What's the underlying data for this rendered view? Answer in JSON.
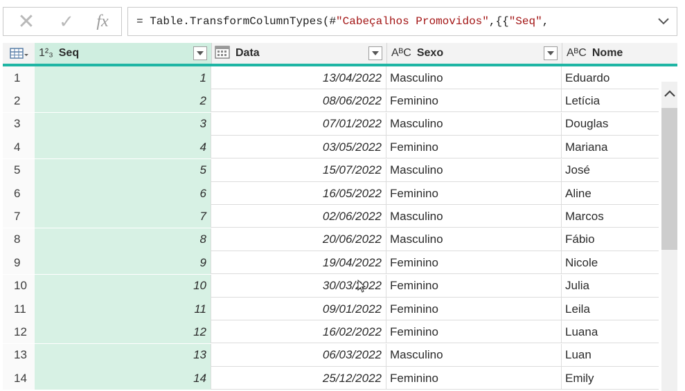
{
  "formula_bar": {
    "cancel_icon": "✕",
    "confirm_icon": "✓",
    "fx_label": "fx",
    "formula_prefix": "= Table.TransformColumnTypes(#",
    "formula_string": "\"Cabeçalhos Promovidos\"",
    "formula_mid": ",{{",
    "formula_string2": "\"Seq\"",
    "formula_suffix": ","
  },
  "columns": [
    {
      "type_icon": "1²₃",
      "label": "Seq"
    },
    {
      "type_icon": "calendar",
      "label": "Data"
    },
    {
      "type_icon": "AᴮC",
      "label": "Sexo"
    },
    {
      "type_icon": "AᴮC",
      "label": "Nome"
    }
  ],
  "rows": [
    {
      "n": "1",
      "seq": "1",
      "data": "13/04/2022",
      "sexo": "Masculino",
      "nome": "Eduardo"
    },
    {
      "n": "2",
      "seq": "2",
      "data": "08/06/2022",
      "sexo": "Feminino",
      "nome": "Letícia"
    },
    {
      "n": "3",
      "seq": "3",
      "data": "07/01/2022",
      "sexo": "Masculino",
      "nome": "Douglas"
    },
    {
      "n": "4",
      "seq": "4",
      "data": "03/05/2022",
      "sexo": "Feminino",
      "nome": "Mariana"
    },
    {
      "n": "5",
      "seq": "5",
      "data": "15/07/2022",
      "sexo": "Masculino",
      "nome": "José"
    },
    {
      "n": "6",
      "seq": "6",
      "data": "16/05/2022",
      "sexo": "Feminino",
      "nome": "Aline"
    },
    {
      "n": "7",
      "seq": "7",
      "data": "02/06/2022",
      "sexo": "Masculino",
      "nome": "Marcos"
    },
    {
      "n": "8",
      "seq": "8",
      "data": "20/06/2022",
      "sexo": "Masculino",
      "nome": "Fábio"
    },
    {
      "n": "9",
      "seq": "9",
      "data": "19/04/2022",
      "sexo": "Feminino",
      "nome": "Nicole"
    },
    {
      "n": "10",
      "seq": "10",
      "data": "30/03/2022",
      "sexo": "Feminino",
      "nome": "Julia"
    },
    {
      "n": "11",
      "seq": "11",
      "data": "09/01/2022",
      "sexo": "Feminino",
      "nome": "Leila"
    },
    {
      "n": "12",
      "seq": "12",
      "data": "16/02/2022",
      "sexo": "Feminino",
      "nome": "Luana"
    },
    {
      "n": "13",
      "seq": "13",
      "data": "06/03/2022",
      "sexo": "Masculino",
      "nome": "Luan"
    },
    {
      "n": "14",
      "seq": "14",
      "data": "25/12/2022",
      "sexo": "Feminino",
      "nome": "Emily"
    }
  ],
  "colors": {
    "accent": "#1fb5a4",
    "selected_column": "#d7f1e4"
  }
}
